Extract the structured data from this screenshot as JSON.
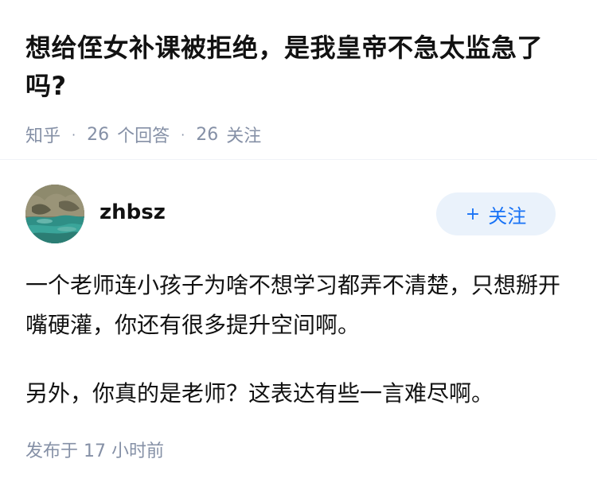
{
  "question": {
    "title": "想给侄女补课被拒绝，是我皇帝不急太监急了吗?",
    "source": "知乎",
    "answer_count": "26",
    "answer_label": "个回答",
    "follower_count": "26",
    "follower_label": "关注",
    "separator": "·"
  },
  "author": {
    "name": "zhbsz",
    "avatar_icon": "landscape-avatar-icon",
    "follow_plus": "+",
    "follow_label": "关注"
  },
  "answer": {
    "paragraphs": [
      "一个老师连小孩子为啥不想学习都弄不清楚，只想掰开嘴硬灌，你还有很多提升空间啊。",
      "另外，你真的是老师？这表达有些一言难尽啊。"
    ]
  },
  "footer": {
    "publish_label": "发布于",
    "publish_time": "17 小时前"
  },
  "colors": {
    "accent": "#1772f6",
    "follow_bg": "#eaf2fb",
    "meta_text": "#8590a6",
    "main_text": "#121212"
  }
}
